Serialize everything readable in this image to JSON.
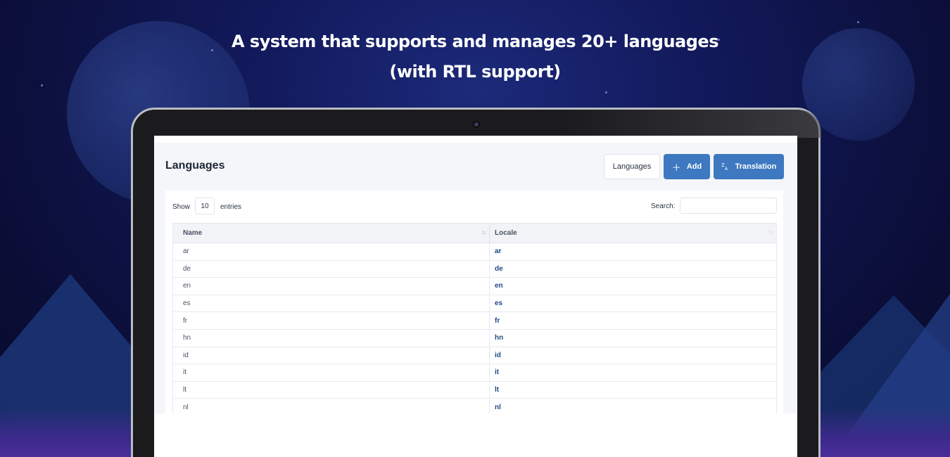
{
  "headline": {
    "line1": "A system that supports and manages 20+ languages",
    "line2": "(with RTL support)"
  },
  "app": {
    "page_title": "Languages",
    "buttons": {
      "languages": "Languages",
      "add": "Add",
      "translation": "Translation"
    },
    "controls": {
      "show_label": "Show",
      "entries_value": "10",
      "entries_label": "entries",
      "search_label": "Search:",
      "search_value": ""
    },
    "table": {
      "columns": [
        "Name",
        "Locale"
      ],
      "rows": [
        {
          "name": "ar",
          "locale": "ar"
        },
        {
          "name": "de",
          "locale": "de"
        },
        {
          "name": "en",
          "locale": "en"
        },
        {
          "name": "es",
          "locale": "es"
        },
        {
          "name": "fr",
          "locale": "fr"
        },
        {
          "name": "hn",
          "locale": "hn"
        },
        {
          "name": "id",
          "locale": "id"
        },
        {
          "name": "it",
          "locale": "it"
        },
        {
          "name": "lt",
          "locale": "lt"
        },
        {
          "name": "nl",
          "locale": "nl"
        }
      ]
    }
  },
  "colors": {
    "primary_button": "#3d78c0",
    "locale_text": "#1f4a85",
    "background_navy": "#12195a"
  },
  "icons": {
    "add": "plus-icon",
    "translation": "translate-icon",
    "sort": "sort-arrows-icon"
  }
}
